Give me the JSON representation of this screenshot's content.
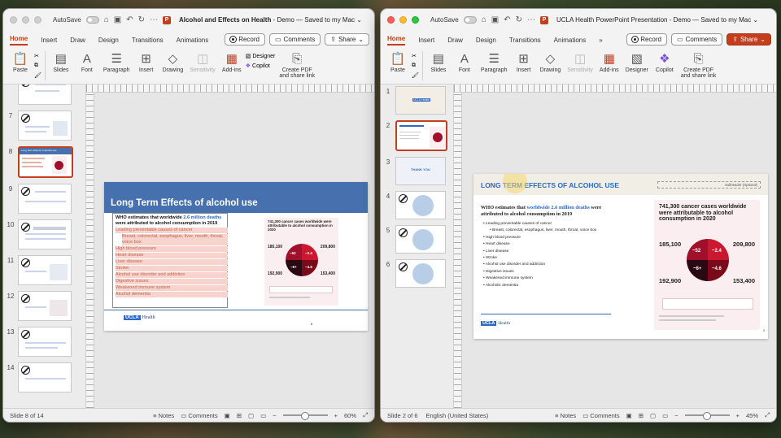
{
  "left_window": {
    "autosave_label": "AutoSave",
    "doc_title": "Alcohol and Effects on Health",
    "doc_status": "- Demo — Saved to my Mac",
    "tabs": [
      "Home",
      "Insert",
      "Draw",
      "Design",
      "Transitions",
      "Animations"
    ],
    "record_label": "Record",
    "comments_label": "Comments",
    "share_label": "Share",
    "ribbon": {
      "paste": "Paste",
      "slides": "Slides",
      "font": "Font",
      "paragraph": "Paragraph",
      "insert": "Insert",
      "drawing": "Drawing",
      "sensitivity": "Sensitivity",
      "addins": "Add-ins",
      "designer": "Designer",
      "copilot": "Copilot",
      "create_pdf_1": "Create PDF",
      "create_pdf_2": "and share link"
    },
    "thumb_numbers": [
      "6",
      "7",
      "8",
      "9",
      "10",
      "11",
      "12",
      "13",
      "14"
    ],
    "thumb8_title": "Long Term Effects of alcohol use",
    "slide": {
      "title": "Long Term Effects of alcohol use",
      "bullet_intro_1": "WHO estimates that worldwide ",
      "bullet_intro_hl": "2.6 million deaths",
      "bullet_intro_2": " were attributed to alcohol consumption in 2019",
      "bullets": [
        "Leading preventable causes of cancer",
        "Breast, colorectal, esophagus, liver, mouth, throat, voice box",
        "High blood pressure",
        "Heart disease",
        "Liver disease",
        "Stroke",
        "Alcohol use disorder and addiction",
        "Digestive issues",
        "Weakened immune system",
        "Alcohol dementia"
      ],
      "page_number": "8",
      "ucla_box": "UCLA",
      "ucla_text": "Health"
    },
    "status": {
      "slide_of": "Slide 8 of 14",
      "notes": "Notes",
      "comments": "Comments",
      "zoom": "60%"
    }
  },
  "right_window": {
    "autosave_label": "AutoSave",
    "doc_title": "UCLA Health PowerPoint Presentation - Demo — Saved to my Mac",
    "tabs": [
      "Home",
      "Insert",
      "Draw",
      "Design",
      "Transitions",
      "Animations"
    ],
    "record_label": "Record",
    "comments_label": "Comments",
    "share_label": "Share",
    "ribbon": {
      "paste": "Paste",
      "slides": "Slides",
      "font": "Font",
      "paragraph": "Paragraph",
      "insert": "Insert",
      "drawing": "Drawing",
      "sensitivity": "Sensitivity",
      "addins": "Add-ins",
      "designer": "Designer",
      "copilot": "Copilot",
      "create_pdf_1": "Create PDF",
      "create_pdf_2": "and share link"
    },
    "thumb_numbers": [
      "1",
      "2",
      "3",
      "4",
      "5",
      "6"
    ],
    "thumb1_text": "UCLA Health",
    "thumb3_text": "THANK YOU",
    "slide": {
      "title": "LONG TERM EFFECTS OF ALCOHOL USE",
      "subtitle_placeholder": "Subheader (Optional)",
      "intro_1": "WHO estimates that ",
      "intro_hl": "worldwide 2.6 million deaths",
      "intro_2": " were attributed to alcohol consumption in 2019",
      "bullets": [
        "Leading preventable causes of cancer",
        "Breast, colorectal, esophagus, liver, mouth, throat, voice box",
        "High blood pressure",
        "Heart disease",
        "Liver disease",
        "Stroke",
        "Alcohol use disorder and addiction",
        "Digestive issues",
        "Weakened immune system",
        "Alcoholic dementia"
      ],
      "page_number": "2",
      "ucla_box": "UCLA",
      "ucla_text": "Health"
    },
    "status": {
      "slide_of": "Slide 2 of 6",
      "language": "English (United States)",
      "notes": "Notes",
      "comments": "Comments",
      "zoom": "45%"
    }
  },
  "infographic": {
    "title": "741,300 cancer cases worldwide were attributable to alcohol consumption in 2020",
    "stats": {
      "top_left": "185,100",
      "top_right": "209,800",
      "bottom_left": "192,900",
      "bottom_right": "153,400",
      "pie_tl": "~52",
      "pie_tr": "~2.4",
      "pie_bl": "~6+",
      "pie_br": "~4.6"
    }
  },
  "colors": {
    "ppt_accent": "#c43e1c",
    "left_title_band": "#4670ae",
    "right_title_text": "#2d68c4",
    "highlight_blue": "#2d68c4",
    "infographic_red": "#c9182f"
  }
}
